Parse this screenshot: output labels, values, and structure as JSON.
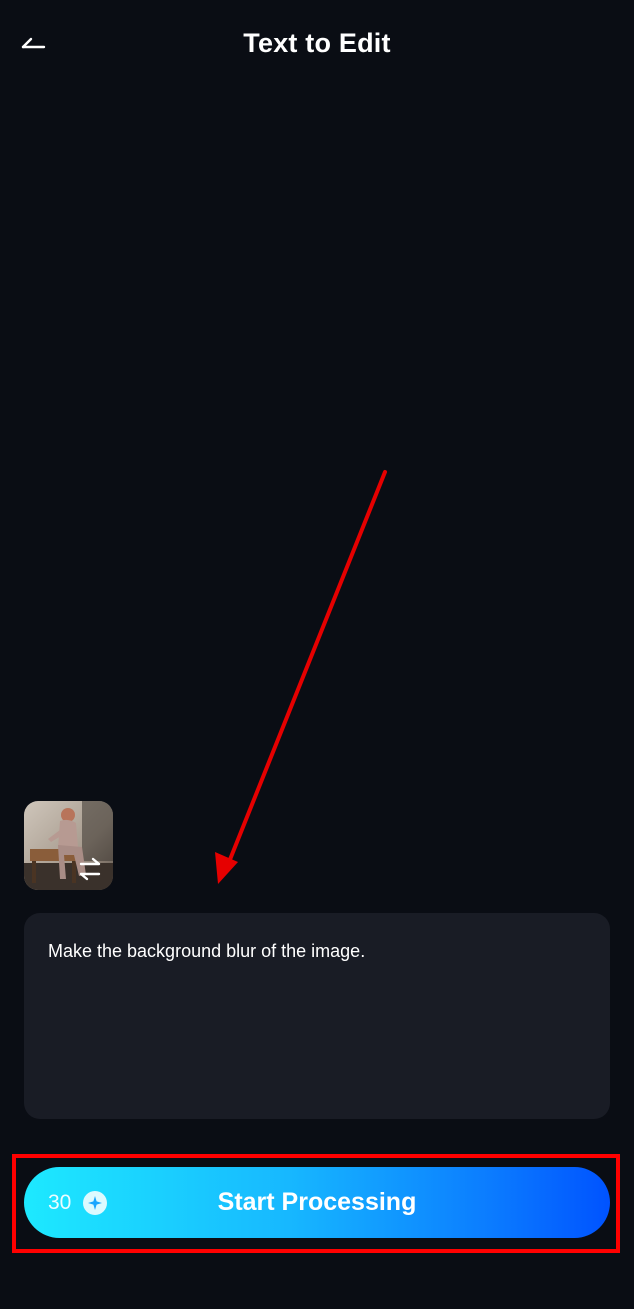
{
  "header": {
    "title": "Text to Edit",
    "back_icon": "back-icon"
  },
  "reference_image": {
    "swap_icon": "swap-icon"
  },
  "prompt": {
    "text": "Make the background blur of the image."
  },
  "start_button": {
    "credits": "30",
    "credits_icon": "sparkle-icon",
    "label": "Start Processing"
  },
  "colors": {
    "background": "#0a0d14",
    "input_bg": "#191c25",
    "button_gradient_start": "#1de9ff",
    "button_gradient_end": "#0053ff",
    "annotation": "#ff0000"
  }
}
